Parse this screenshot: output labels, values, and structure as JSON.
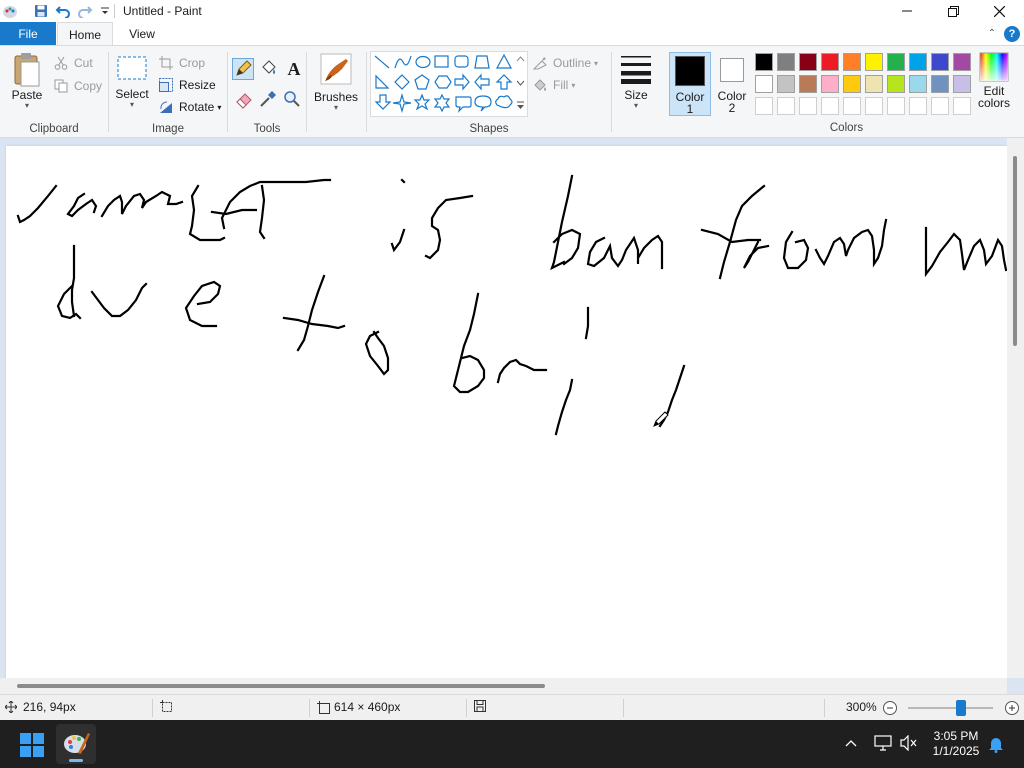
{
  "window": {
    "title": "Untitled - Paint"
  },
  "tabs": {
    "file": "File",
    "home": "Home",
    "view": "View"
  },
  "help": "?",
  "clipboard": {
    "paste": "Paste",
    "cut": "Cut",
    "copy": "Copy",
    "label": "Clipboard"
  },
  "image": {
    "select": "Select",
    "crop": "Crop",
    "resize": "Resize",
    "rotate": "Rotate",
    "label": "Image"
  },
  "tools": {
    "label": "Tools",
    "text_tool_glyph": "A"
  },
  "brushes": {
    "label": "Brushes"
  },
  "shapes": {
    "outline": "Outline",
    "fill": "Fill",
    "label": "Shapes"
  },
  "size": {
    "label": "Size"
  },
  "color1": {
    "label": "Color",
    "num": "1",
    "value": "#000000"
  },
  "color2": {
    "label": "Color",
    "num": "2",
    "value": "#ffffff"
  },
  "colors": {
    "label": "Colors",
    "edit_line1": "Edit",
    "edit_line2": "colors",
    "row1": [
      "#000000",
      "#7f7f7f",
      "#880015",
      "#ed1c24",
      "#ff7f27",
      "#fff200",
      "#22b14c",
      "#00a2e8",
      "#3f48cc",
      "#a349a4"
    ],
    "row2": [
      "#ffffff",
      "#c3c3c3",
      "#b97a57",
      "#ffaec9",
      "#ffc90e",
      "#efe4b0",
      "#b5e61d",
      "#99d9ea",
      "#7092be",
      "#c8bfe7"
    ]
  },
  "canvas": {
    "handwriting": "James is ban from VM due to bri!!"
  },
  "status": {
    "cursor_pos": "216, 94px",
    "canvas_size": "614 × 460px",
    "zoom": "300%"
  },
  "taskbar": {
    "time": "3:05 PM",
    "date": "1/1/2025"
  }
}
